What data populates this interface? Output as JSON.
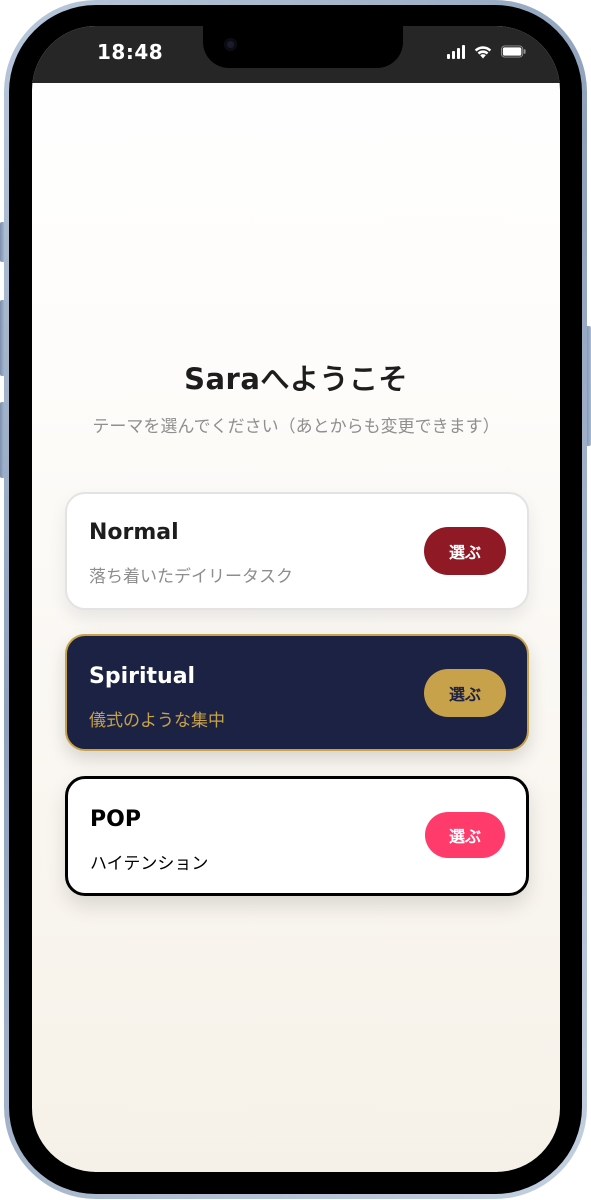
{
  "status_bar": {
    "time": "18:48"
  },
  "welcome": {
    "title": "Saraへようこそ",
    "subtitle": "テーマを選んでください（あとからも変更できます）"
  },
  "themes": [
    {
      "title": "Normal",
      "description": "落ち着いたデイリータスク",
      "button_label": "選ぶ"
    },
    {
      "title": "Spiritual",
      "description": "儀式のような集中",
      "button_label": "選ぶ"
    },
    {
      "title": "POP",
      "description": "ハイテンション",
      "button_label": "選ぶ"
    }
  ],
  "colors": {
    "normal_accent": "#8f1a26",
    "spiritual_background": "#1c2243",
    "spiritual_accent": "#c8a24a",
    "pop_accent": "#ff3b6b"
  },
  "icons": {
    "signal": "cellular-signal-icon",
    "wifi": "wifi-icon",
    "battery": "battery-icon"
  }
}
